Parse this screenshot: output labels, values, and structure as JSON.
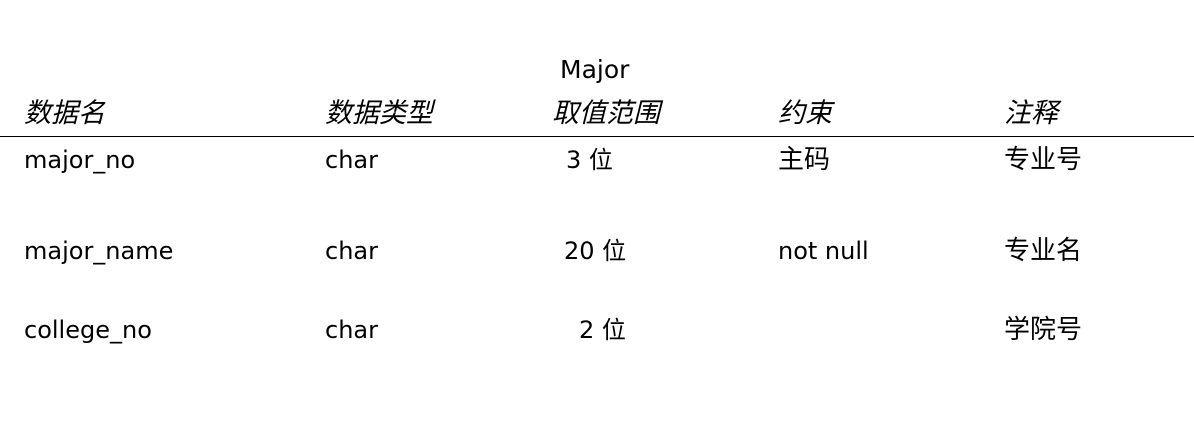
{
  "table": {
    "title": "Major",
    "headers": [
      "数据名",
      "数据类型",
      "取值范围",
      "约束",
      "注释"
    ],
    "rows": [
      {
        "name": "major_no",
        "type": "char",
        "range": "3 位",
        "constraint": "主码",
        "comment": "专业号"
      },
      {
        "name": "major_name",
        "type": "char",
        "range": "20 位",
        "constraint": "not null",
        "comment": "专业名"
      },
      {
        "name": "college_no",
        "type": "char",
        "range": "2 位",
        "constraint": "",
        "comment": "学院号"
      }
    ]
  }
}
